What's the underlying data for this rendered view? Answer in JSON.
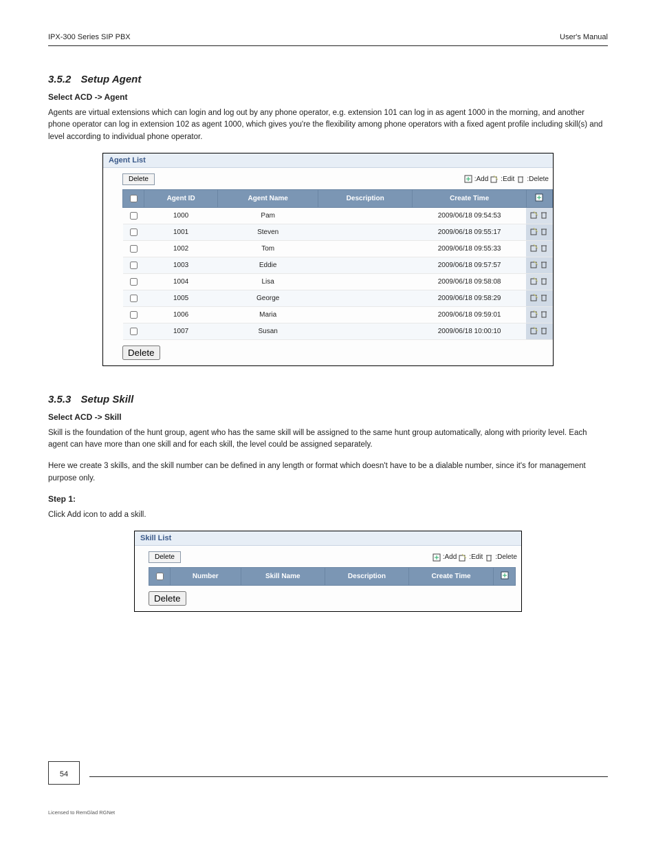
{
  "running_header": {
    "left": "IPX-300 Series SIP PBX",
    "right": "User's Manual"
  },
  "section_3_5_2": {
    "heading_num": "3.5.2",
    "heading_text": "Setup Agent",
    "sub1_title": "Select ACD -> Agent",
    "sub1_text": "Agents are virtual extensions which can login and log out by any phone operator, e.g. extension 101 can log in as agent 1000 in the morning, and another phone operator can log in extension 102 as agent 1000, which gives you're the flexibility among phone operators with a fixed agent profile including skill(s) and level according to individual phone operator.",
    "panel": {
      "title": "Agent List",
      "delete_btn": "Delete",
      "legend": {
        "add": ":Add",
        "edit": ":Edit",
        "delete": ":Delete"
      },
      "columns": [
        "",
        "Agent ID",
        "Agent Name",
        "Description",
        "Create Time",
        ""
      ],
      "rows": [
        {
          "id": "1000",
          "name": "Pam",
          "desc": "",
          "time": "2009/06/18 09:54:53"
        },
        {
          "id": "1001",
          "name": "Steven",
          "desc": "",
          "time": "2009/06/18 09:55:17"
        },
        {
          "id": "1002",
          "name": "Tom",
          "desc": "",
          "time": "2009/06/18 09:55:33"
        },
        {
          "id": "1003",
          "name": "Eddie",
          "desc": "",
          "time": "2009/06/18 09:57:57"
        },
        {
          "id": "1004",
          "name": "Lisa",
          "desc": "",
          "time": "2009/06/18 09:58:08"
        },
        {
          "id": "1005",
          "name": "George",
          "desc": "",
          "time": "2009/06/18 09:58:29"
        },
        {
          "id": "1006",
          "name": "Maria",
          "desc": "",
          "time": "2009/06/18 09:59:01"
        },
        {
          "id": "1007",
          "name": "Susan",
          "desc": "",
          "time": "2009/06/18 10:00:10"
        }
      ]
    }
  },
  "section_3_5_3": {
    "heading_num": "3.5.3",
    "heading_text": "Setup Skill",
    "sub1_title": "Select ACD -> Skill",
    "para1": "Skill is the foundation of the hunt group, agent who has the same skill will be assigned to the same hunt group automatically, along with priority level. Each agent can have more than one skill and for each skill, the level could be assigned separately.",
    "para2": "Here we create 3 skills, and the skill number can be defined in any length or format which doesn't have to be a dialable number, since it's for management purpose only.",
    "sub2_title": "Step 1:",
    "sub2_text": "Click Add icon to add a skill.",
    "panel": {
      "title": "Skill List",
      "delete_btn": "Delete",
      "legend": {
        "add": ":Add",
        "edit": ":Edit",
        "delete": ":Delete"
      },
      "columns": [
        "",
        "Number",
        "Skill Name",
        "Description",
        "Create Time",
        ""
      ],
      "rows": []
    }
  },
  "footer": {
    "page": "54",
    "license": "Licensed to RemGlad RGNet"
  }
}
